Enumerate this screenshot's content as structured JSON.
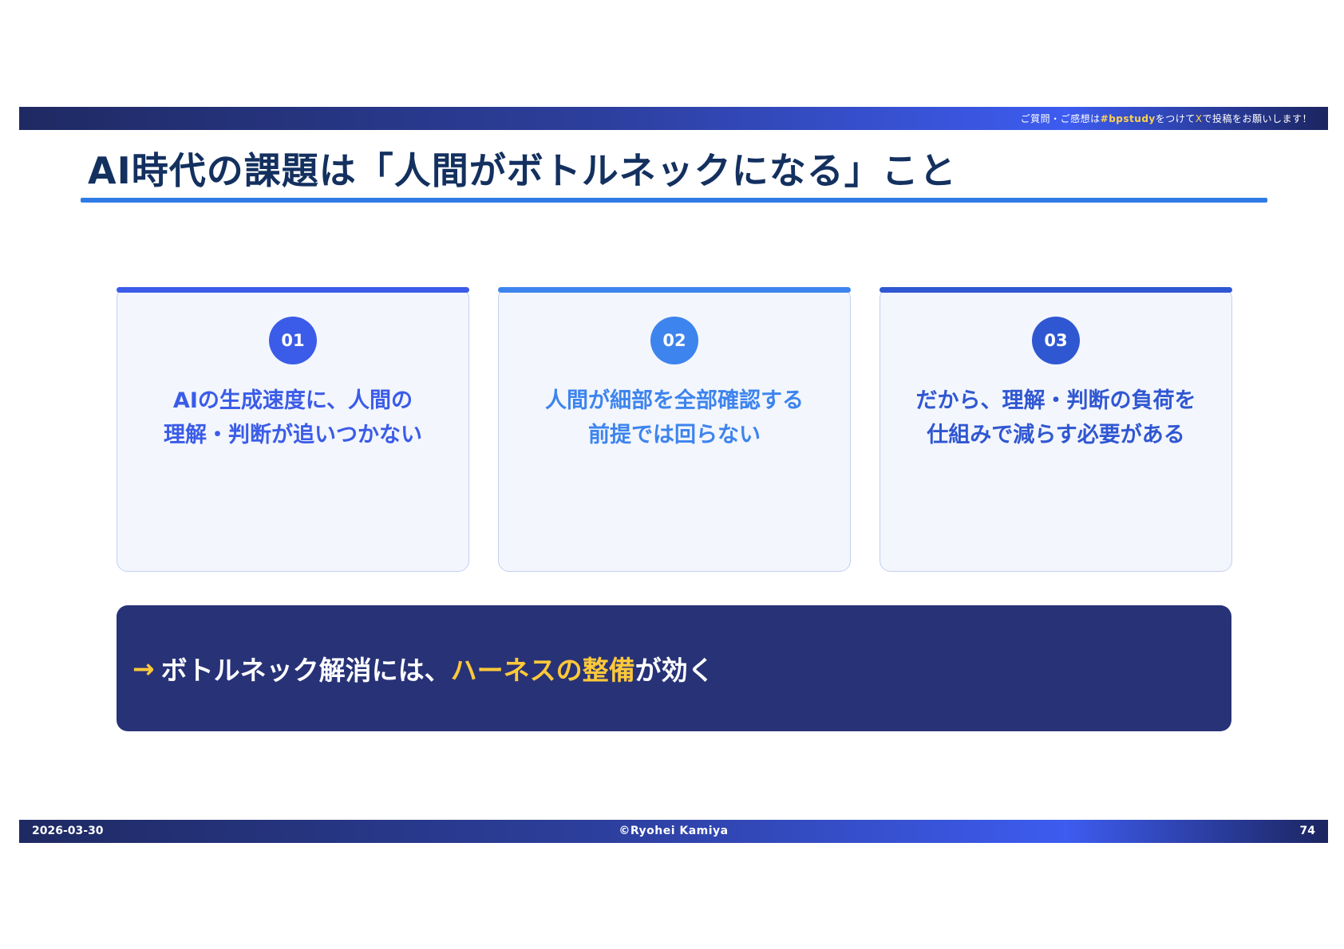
{
  "header_bar": {
    "prefix": "ご質問・ご感想は",
    "hashtag": "#bpstudy",
    "middle": "をつけて",
    "platform": "X",
    "suffix": "で投稿をお願いします！"
  },
  "title": "AI時代の課題は「人間がボトルネックになる」こと",
  "cards": [
    {
      "number": "01",
      "line1": "AIの生成速度に、人間の",
      "line2": "理解・判断が追いつかない",
      "accent_color": "#3b5ce8",
      "text_color": "#3b5ce8"
    },
    {
      "number": "02",
      "line1": "人間が細部を全部確認する",
      "line2": "前提では回らない",
      "accent_color": "#3d84ee",
      "text_color": "#3d84ee"
    },
    {
      "number": "03",
      "line1": "だから、理解・判断の負荷を",
      "line2": "仕組みで減らす必要がある",
      "accent_color": "#3057d2",
      "text_color": "#3057d2"
    }
  ],
  "conclusion": {
    "arrow": "→",
    "lead": "ボトルネック解消には、",
    "highlight": "ハーネスの整備",
    "tail": "が効く"
  },
  "footer": {
    "date": "2026-03-30",
    "copyright": "©Ryohei Kamiya",
    "page_number": "74"
  }
}
